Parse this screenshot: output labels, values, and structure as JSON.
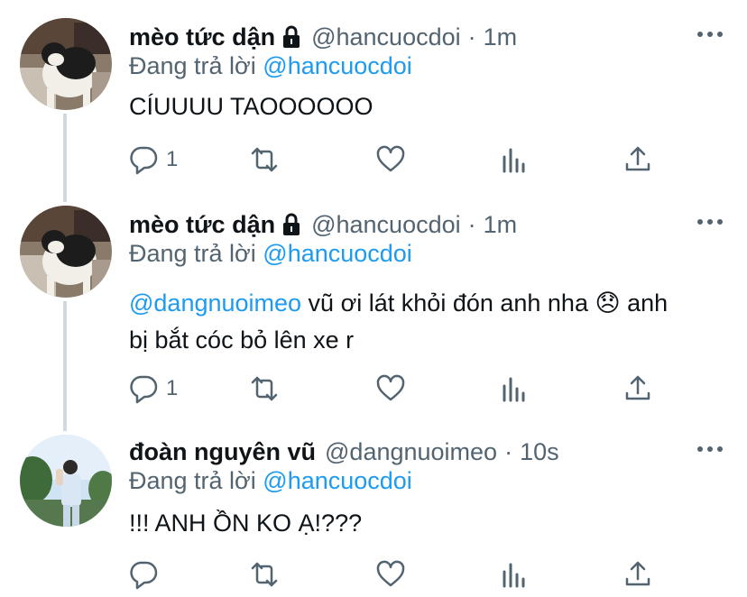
{
  "colors": {
    "accent": "#1d9bf0",
    "text": "#0f1419",
    "muted": "#536471",
    "thread_line": "#cfd9de"
  },
  "tweets": [
    {
      "display_name": "mèo tức dận",
      "protected": true,
      "handle": "@hancuocdoi",
      "separator": "·",
      "time": "1m",
      "reply_prefix": "Đang trả lời",
      "reply_to": "@hancuocdoi",
      "text": "CÍUUUU TAOOOOOO",
      "reply_count": "1",
      "avatar": "cat-photo"
    },
    {
      "display_name": "mèo tức dận",
      "protected": true,
      "handle": "@hancuocdoi",
      "separator": "·",
      "time": "1m",
      "reply_prefix": "Đang trả lời",
      "reply_to": "@hancuocdoi",
      "text_mention": "@dangnuoimeo",
      "text_line1": " vũ ơi lát khỏi đón anh nha ",
      "emoji": "😞",
      "text_line1_end": " anh",
      "text_line2": "bị bắt cóc bỏ lên xe r",
      "reply_count": "1",
      "avatar": "cat-photo"
    },
    {
      "display_name": "đoàn nguyên vũ",
      "protected": false,
      "handle": "@dangnuoimeo",
      "separator": "·",
      "time": "10s",
      "reply_prefix": "Đang trả lời",
      "reply_to": "@hancuocdoi",
      "text": "!!! ANH ỒN KO Ạ!???",
      "reply_count": "",
      "avatar": "person-photo"
    }
  ],
  "icons": [
    "reply-icon",
    "retweet-icon",
    "like-icon",
    "analytics-icon",
    "share-icon",
    "more-icon",
    "lock-icon"
  ]
}
